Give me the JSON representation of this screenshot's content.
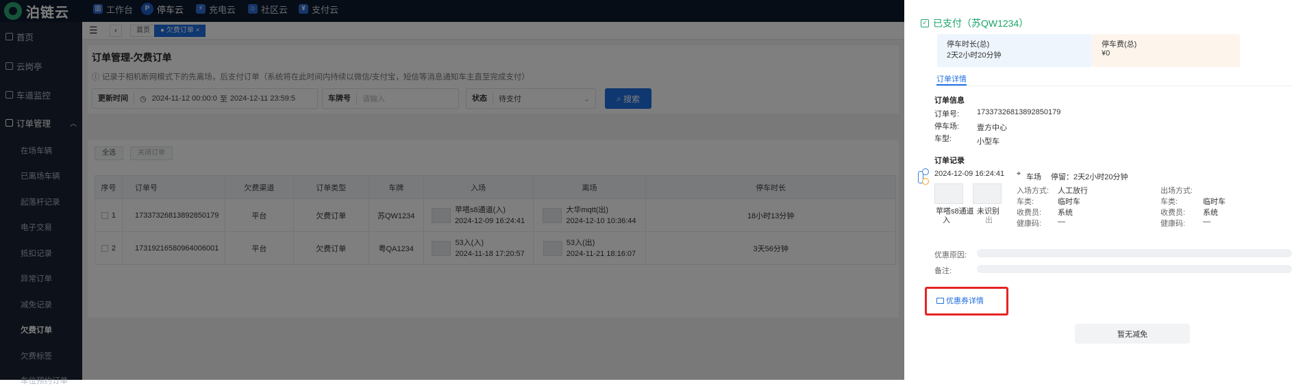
{
  "brand": {
    "name": "泊链云"
  },
  "topnav": [
    {
      "label": "工作台",
      "icon": "workbench-icon"
    },
    {
      "label": "停车云",
      "icon": "parking-p-icon"
    },
    {
      "label": "充电云",
      "icon": "charging-icon"
    },
    {
      "label": "社区云",
      "icon": "community-icon"
    },
    {
      "label": "支付云",
      "icon": "payment-icon"
    }
  ],
  "sidebar": {
    "items": [
      {
        "label": "首页"
      },
      {
        "label": "云岗亭"
      },
      {
        "label": "车道监控"
      },
      {
        "label": "订单管理"
      }
    ],
    "sub": [
      "在场车辆",
      "已离场车辆",
      "起落杆记录",
      "电子交易",
      "抵扣记录",
      "异常订单",
      "减免记录",
      "欠费订单",
      "欠费标签",
      "车位预约订单"
    ]
  },
  "tabs": {
    "home": "首页",
    "current": "欠费订单"
  },
  "page": {
    "title": "订单管理-欠费订单",
    "note": "记录于相机断网模式下的先离场，后支付订单（系统将在此时间内持续以微信/支付宝，短信等消息通知车主直至完成支付）"
  },
  "filters": {
    "time_label": "更新时间",
    "time_start": "2024-11-12 00:00:0",
    "time_sep": "至",
    "time_end": "2024-12-11 23:59:5",
    "plate_label": "车牌号",
    "plate_placeholder": "请输入",
    "status_label": "状态",
    "status_value": "待支付",
    "search": "搜索"
  },
  "table_actions": {
    "select_all": "全选",
    "close_order": "关闭订单"
  },
  "table": {
    "headers": [
      "序号",
      "订单号",
      "欠费渠道",
      "订单类型",
      "车牌",
      "入场",
      "离场",
      "停车时长"
    ],
    "rows": [
      {
        "idx": "1",
        "order_no": "17337326813892850179",
        "channel": "平台",
        "type": "欠费订单",
        "plate": "苏QW1234",
        "in_gate": "苹嗒s8通道(入)",
        "in_time": "2024-12-09 16:24:41",
        "out_gate": "大华mqtt(出)",
        "out_time": "2024-12-10 10:36:44",
        "duration": "18小时13分钟"
      },
      {
        "idx": "2",
        "order_no": "17319216580964006001",
        "channel": "平台",
        "type": "欠费订单",
        "plate": "粤QA1234",
        "in_gate": "53入(入)",
        "in_time": "2024-11-18 17:20:57",
        "out_gate": "53入(出)",
        "out_time": "2024-11-21 18:16:07",
        "duration": "3天56分钟"
      }
    ]
  },
  "drawer": {
    "status_title": "已支付（苏QW1234）",
    "duration_label": "停车时长(总)",
    "duration_value": "2天2小时20分钟",
    "fee_label": "停车费(总)",
    "fee_value": "¥0",
    "detail_tab": "订单详情",
    "order_info_title": "订单信息",
    "order_no_label": "订单号:",
    "order_no": "17337326813892850179",
    "lot_label": "停车场:",
    "lot": "壹方中心",
    "cartype_label": "车型:",
    "cartype": "小型车",
    "record_title": "订单记录",
    "record_time": "2024-12-09 16:24:41",
    "record_place": "车场",
    "record_stay": "停留：2天2小时20分钟",
    "in_caption": "苹嗒s8通道",
    "in_caption2": "入",
    "out_caption": "未识别",
    "out_caption2": "出",
    "entry_method_label": "入场方式:",
    "entry_method": "人工放行",
    "in_type_label": "车类:",
    "in_type": "临时车",
    "in_cashier_label": "收费员:",
    "in_cashier": "系统",
    "in_health_label": "健康码:",
    "in_health": "—",
    "exit_method_label": "出场方式:",
    "exit_method": "",
    "out_type_label": "车类:",
    "out_type": "临时车",
    "out_cashier_label": "收费员:",
    "out_cashier": "系统",
    "out_health_label": "健康码:",
    "out_health": "—",
    "discount_reason_label": "优惠原因:",
    "remark_label": "备注:",
    "coupon_link": "优惠券详情",
    "no_reduction": "暂无减免"
  },
  "colors": {
    "accent": "#1f6fe0",
    "paid_green": "#1aa36a",
    "highlight_red": "#e62222"
  }
}
